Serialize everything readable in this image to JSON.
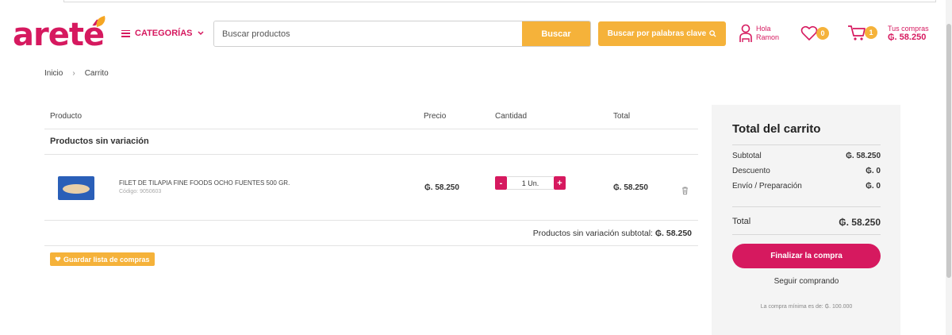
{
  "header": {
    "logo": "areté",
    "categories_label": "CATEGORÍAS",
    "search_placeholder": "Buscar productos",
    "search_button": "Buscar",
    "keyword_button": "Buscar por palabras clave",
    "user_greeting": "Hola",
    "user_name": "Ramon",
    "favorites_count": "0",
    "cart_count": "1",
    "cart_label": "Tus compras",
    "cart_total": "₲. 58.250"
  },
  "breadcrumb": {
    "home": "Inicio",
    "separator": "›",
    "current": "Carrito"
  },
  "table": {
    "headers": {
      "product": "Producto",
      "price": "Precio",
      "quantity": "Cantidad",
      "total": "Total"
    },
    "group_title": "Productos sin variación",
    "items": [
      {
        "name": "FILET DE TILAPIA FINE FOODS OCHO FUENTES 500 GR.",
        "code": "Código: 9050603",
        "price": "₲. 58.250",
        "quantity": "1 Un.",
        "minus": "-",
        "plus": "+",
        "total": "₲. 58.250"
      }
    ],
    "subtotal_text": "Productos sin variación subtotal: ",
    "subtotal_value": "₲. 58.250"
  },
  "save_list_button": "Guardar lista de compras",
  "summary": {
    "title": "Total del carrito",
    "subtotal_label": "Subtotal",
    "subtotal_value": "₲. 58.250",
    "discount_label": "Descuento",
    "discount_value": "₲. 0",
    "shipping_label": "Envío / Preparación",
    "shipping_value": "₲. 0",
    "total_label": "Total",
    "total_value": "₲. 58.250",
    "finish_button": "Finalizar la compra",
    "keep_shopping": "Seguir comprando",
    "minimum_note": "La compra mínima es de: ₲. 100.000"
  },
  "colors": {
    "brand": "#d6195f",
    "accent": "#f5b23a"
  }
}
